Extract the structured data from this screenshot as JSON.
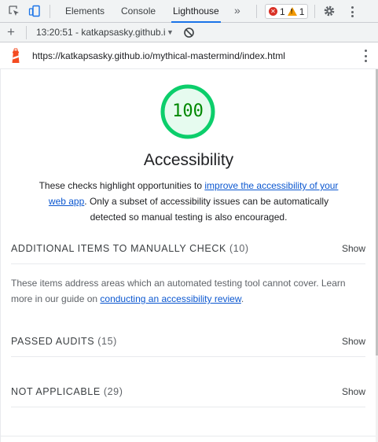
{
  "devtools": {
    "tabs": [
      {
        "label": "Elements"
      },
      {
        "label": "Console"
      },
      {
        "label": "Lighthouse"
      }
    ],
    "more_tabs": "»",
    "issues": {
      "errors": "1",
      "warnings": "1"
    }
  },
  "toolbar": {
    "add_label": "+",
    "report_label": "13:20:51 - katkapsasky.github.i",
    "caret": "▼"
  },
  "url": "https://katkapsasky.github.io/mythical-mastermind/index.html",
  "report": {
    "score": "100",
    "title": "Accessibility",
    "desc_before": "These checks highlight opportunities to ",
    "desc_link": "improve the accessibility of your web app",
    "desc_after": ". Only a subset of accessibility issues can be automatically detected so manual testing is also encouraged.",
    "groups": [
      {
        "title": "Additional items to manually check",
        "count": "(10)",
        "show": "Show"
      },
      {
        "title": "Passed audits",
        "count": "(15)",
        "show": "Show"
      },
      {
        "title": "Not applicable",
        "count": "(29)",
        "show": "Show"
      }
    ],
    "manual_desc_before": "These items address areas which an automated testing tool cannot cover. Learn more in our guide on ",
    "manual_desc_link": "conducting an accessibility review",
    "manual_desc_after": "."
  },
  "colors": {
    "score_pass": "#0cce6b",
    "score_text": "#008800",
    "link": "#0b57d0",
    "active_tab": "#1a73e8"
  },
  "icons": [
    "inspect-icon",
    "device-toolbar-icon",
    "error-icon",
    "warning-icon",
    "gear-icon",
    "kebab-menu-icon",
    "clear-icon",
    "lighthouse-logo-icon"
  ]
}
